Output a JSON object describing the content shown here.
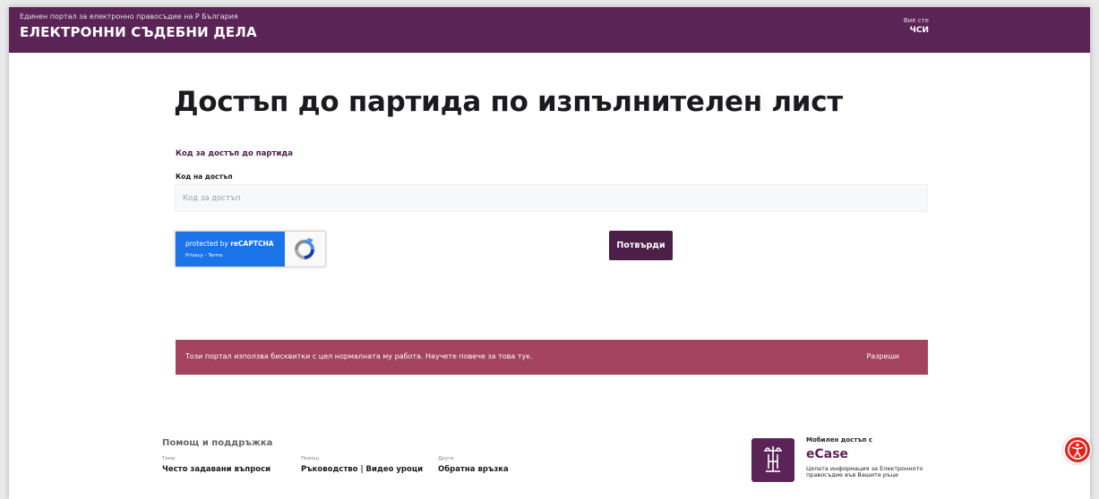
{
  "header": {
    "subtitle": "Единен портал за електронно правосъдие на Р България",
    "brand": "ЕЛЕКТРОННИ СЪДЕБНИ ДЕЛА",
    "you_are": "Вие сте",
    "role": "ЧСИ"
  },
  "main": {
    "title": "Достъп до партида по изпълнителен лист",
    "section_label": "Код за достъп до партида",
    "field_label": "Код на достъп",
    "field_placeholder": "Код за достъп",
    "field_value": "",
    "recaptcha_protected_prefix": "protected by ",
    "recaptcha_protected_brand": "reCAPTCHA",
    "recaptcha_privacy": "Privacy - Terms",
    "confirm_label": "Потвърди"
  },
  "cookie_bar": {
    "message": "Този портал използва бисквитки с цел нормалната му работа. Научете повече за това тук.",
    "allow_label": "Разреши"
  },
  "footer": {
    "help_title": "Помощ и поддръжка",
    "columns": [
      {
        "caption": "Теми",
        "link": "Често задавани въпроси"
      },
      {
        "caption": "Помощ",
        "link": "Ръководство | Видео уроци"
      },
      {
        "caption": "Други",
        "link": "Обратна връзка"
      }
    ],
    "ecase_mobile": "Мобилен достъп с",
    "ecase_name": "eCase",
    "ecase_desc": "Цялата информация за Електронното правосъдие във Вашите ръце"
  },
  "colors": {
    "brand": "#5b2456",
    "button": "#4b1f48",
    "cookie_bar": "#a3435f",
    "recaptcha_blue": "#1a73e8",
    "accessibility": "#e2231a"
  },
  "icons": {
    "recaptcha": "recaptcha-logo-icon",
    "ecase": "justice-pillar-icon",
    "accessibility": "accessibility-icon"
  }
}
